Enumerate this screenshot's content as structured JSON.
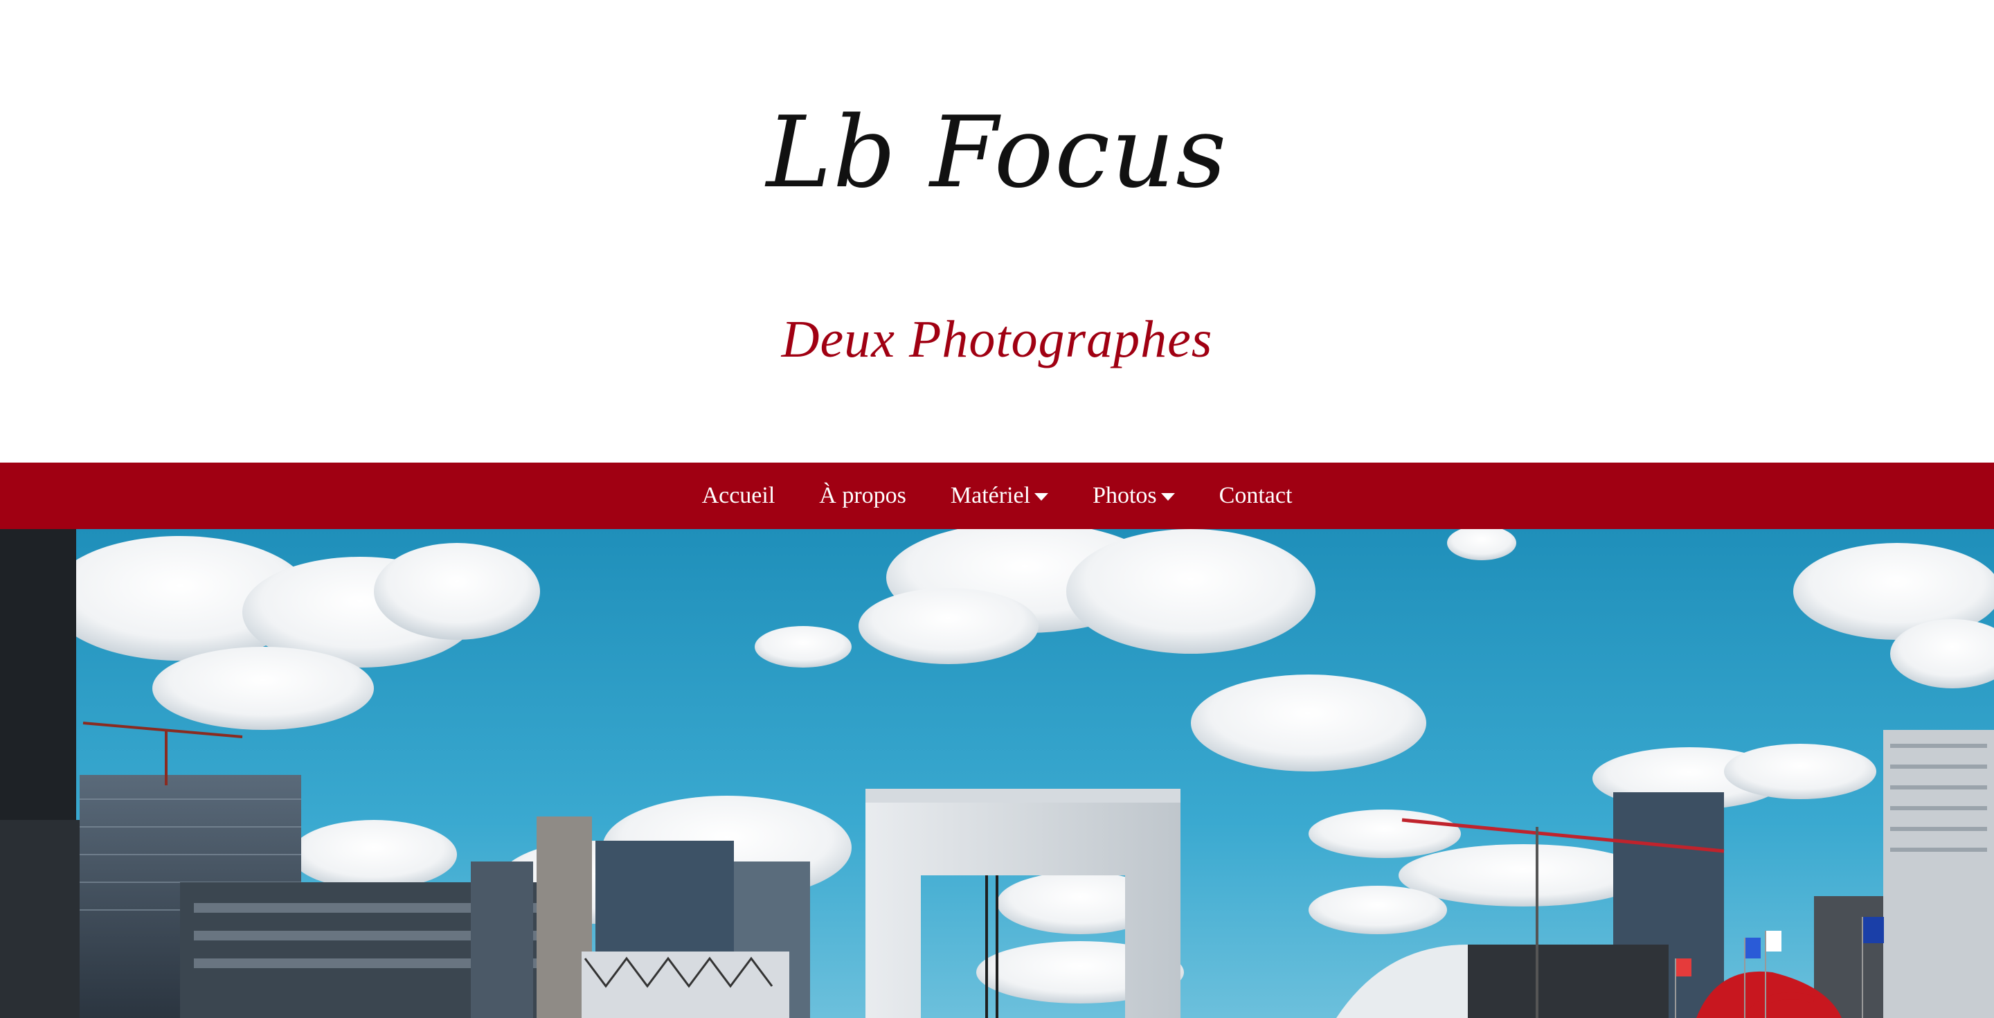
{
  "site": {
    "title": "Lb Focus",
    "tagline": "Deux Photographes"
  },
  "nav": {
    "items": [
      {
        "label": "Accueil",
        "has_dropdown": false
      },
      {
        "label": "À propos",
        "has_dropdown": false
      },
      {
        "label": "Matériel",
        "has_dropdown": true
      },
      {
        "label": "Photos",
        "has_dropdown": true
      },
      {
        "label": "Contact",
        "has_dropdown": false
      }
    ]
  },
  "hero": {
    "image": "la-defense-grande-arche-photo"
  },
  "colors": {
    "brand_red": "#a00012",
    "title_black": "#111111",
    "sky_blue": "#2d9fc6"
  }
}
